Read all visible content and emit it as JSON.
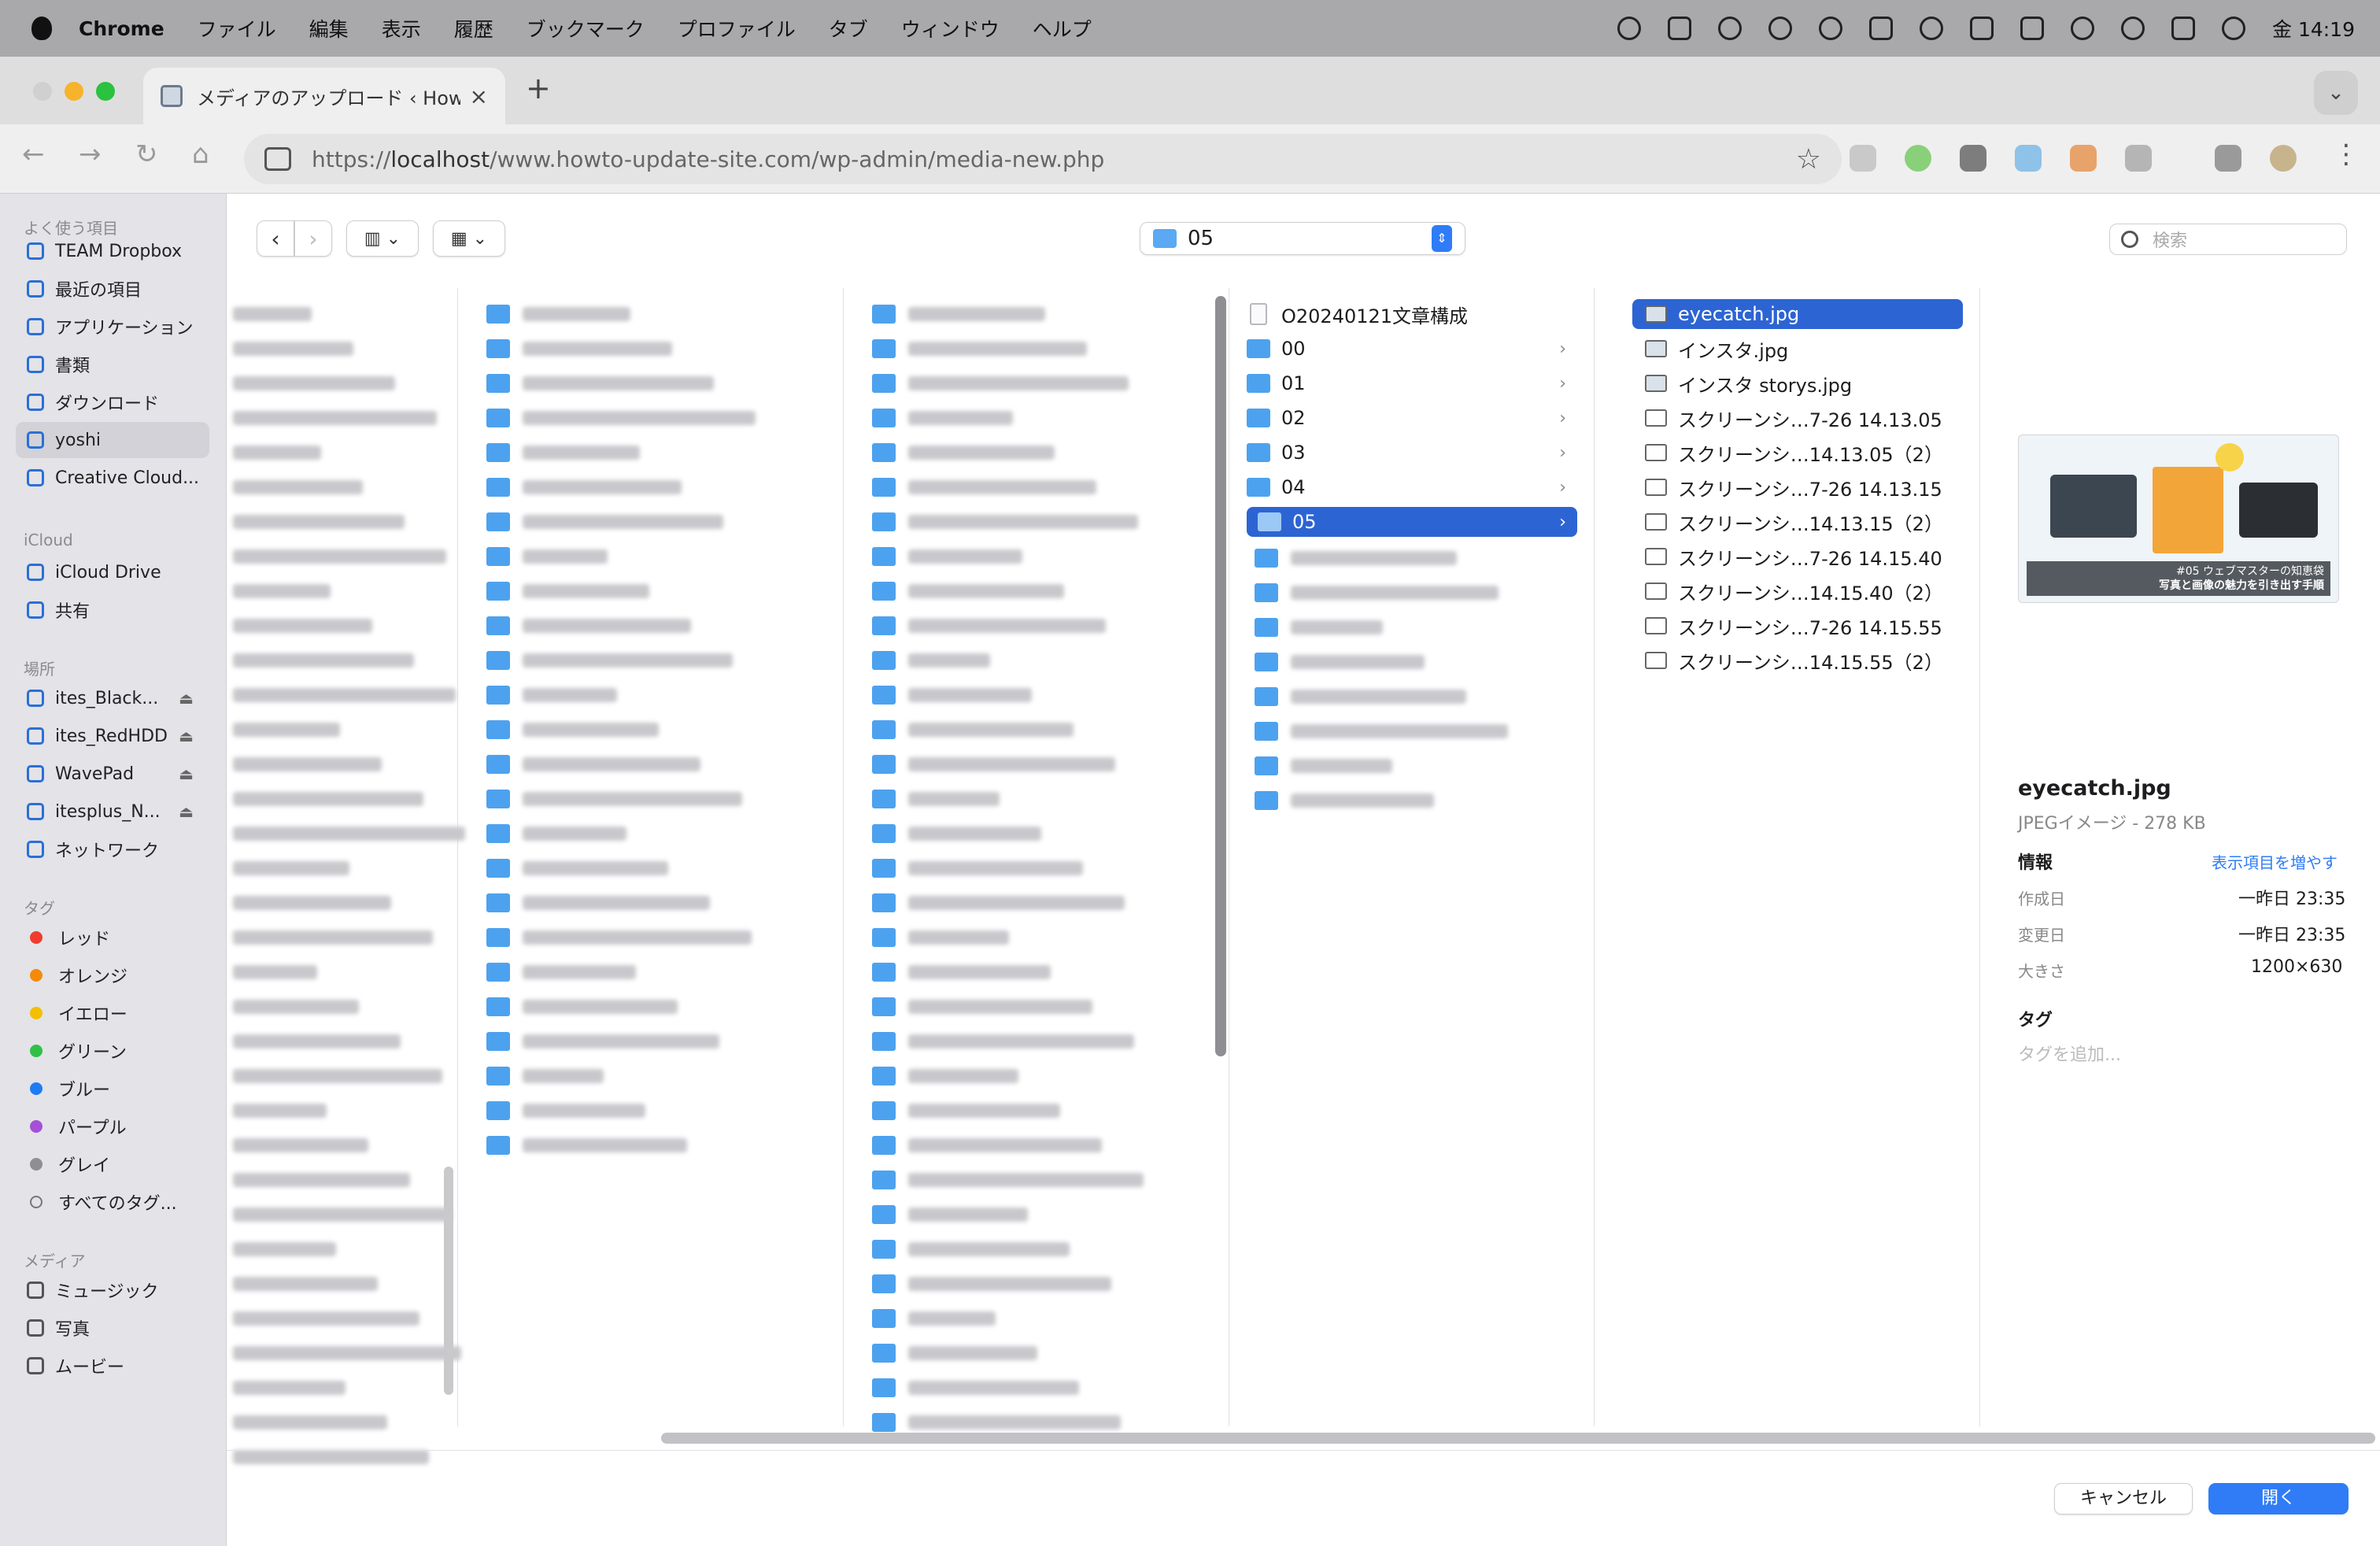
{
  "menubar": {
    "app": "Chrome",
    "items": [
      "ファイル",
      "編集",
      "表示",
      "履歴",
      "ブックマーク",
      "プロファイル",
      "タブ",
      "ウィンドウ",
      "ヘルプ"
    ],
    "clock": "金 14:19"
  },
  "browser": {
    "tab_title": "メディアのアップロード ‹ How T",
    "url_scheme": "https://",
    "url_host": "localhost",
    "url_path": "/www.howto-update-site.com/wp-admin/media-new.php"
  },
  "sidebar": {
    "favorites_header": "よく使う項目",
    "favorites": [
      "TEAM Dropbox",
      "最近の項目",
      "アプリケーション",
      "書類",
      "ダウンロード",
      "yoshi",
      "Creative Cloud..."
    ],
    "icloud_header": "iCloud",
    "icloud": [
      "iCloud Drive",
      "共有"
    ],
    "locations_header": "場所",
    "locations": [
      "ites_Black...",
      "ites_RedHDD",
      "WavePad",
      "itesplus_N...",
      "ネットワーク"
    ],
    "tags_header": "タグ",
    "tags": [
      {
        "label": "レッド",
        "color": "#f03b30"
      },
      {
        "label": "オレンジ",
        "color": "#f58a0a"
      },
      {
        "label": "イエロー",
        "color": "#f4bf00"
      },
      {
        "label": "グリーン",
        "color": "#30c048"
      },
      {
        "label": "ブルー",
        "color": "#1e7cf2"
      },
      {
        "label": "パープル",
        "color": "#a550d8"
      },
      {
        "label": "グレイ",
        "color": "#8e8e93"
      },
      {
        "label": "すべてのタグ...",
        "color": ""
      }
    ],
    "media_header": "メディア",
    "media": [
      "ミュージック",
      "写真",
      "ムービー"
    ]
  },
  "location_popup": "05",
  "search_placeholder": "検索",
  "column4": [
    {
      "name": "O20240121文章構成",
      "type": "doc",
      "chevron": false
    },
    {
      "name": "00",
      "type": "folder",
      "chevron": true
    },
    {
      "name": "01",
      "type": "folder",
      "chevron": true
    },
    {
      "name": "02",
      "type": "folder",
      "chevron": true
    },
    {
      "name": "03",
      "type": "folder",
      "chevron": true
    },
    {
      "name": "04",
      "type": "folder",
      "chevron": true
    },
    {
      "name": "05",
      "type": "folder",
      "chevron": true,
      "selected": true
    }
  ],
  "column5": [
    {
      "name": "eyecatch.jpg",
      "selected": true
    },
    {
      "name": "インスタ.jpg"
    },
    {
      "name": "インスタ storys.jpg"
    },
    {
      "name": "スクリーンシ…7-26 14.13.05"
    },
    {
      "name": "スクリーンシ…14.13.05（2）"
    },
    {
      "name": "スクリーンシ…7-26 14.13.15"
    },
    {
      "name": "スクリーンシ…14.13.15（2）"
    },
    {
      "name": "スクリーンシ…7-26 14.15.40"
    },
    {
      "name": "スクリーンシ…14.15.40（2）"
    },
    {
      "name": "スクリーンシ…7-26 14.15.55"
    },
    {
      "name": "スクリーンシ…14.15.55（2）"
    }
  ],
  "preview": {
    "thumb_caption_1": "#05 ウェブマスターの知恵袋",
    "thumb_caption_2": "写真と画像の魅力を引き出す手順",
    "filename": "eyecatch.jpg",
    "kind": "JPEGイメージ - 278 KB",
    "info_header": "情報",
    "show_more": "表示項目を増やす",
    "created_label": "作成日",
    "created_value": "一昨日 23:35",
    "modified_label": "変更日",
    "modified_value": "一昨日 23:35",
    "size_label": "大きさ",
    "size_value": "1200×630",
    "tags_header": "タグ",
    "tags_placeholder": "タグを追加..."
  },
  "buttons": {
    "cancel": "キャンセル",
    "open": "開く"
  }
}
